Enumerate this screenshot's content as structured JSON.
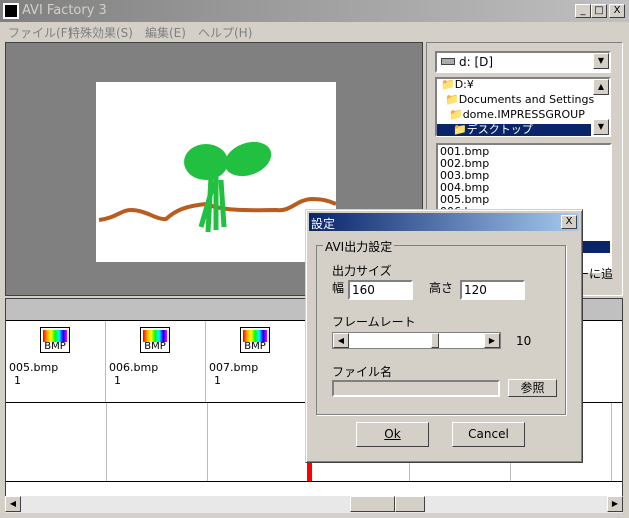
{
  "window": {
    "title": "AVI Factory 3",
    "min": "_",
    "max": "□",
    "close": "X"
  },
  "menu": [
    "ファイル(F)",
    "特殊効果(S)",
    "編集(E)",
    "ヘルプ(H)"
  ],
  "right_panel": {
    "drive": "d: [D]",
    "tree": [
      "D:¥",
      "Documents and Settings",
      "dome.IMPRESSGROUP",
      "デスクトップ"
    ],
    "files": [
      "001.bmp",
      "002.bmp",
      "003.bmp",
      "004.bmp",
      "005.bmp",
      "006.bmp"
    ],
    "add_label": "ーに追"
  },
  "timeline": {
    "frames": [
      {
        "icon": "BMP",
        "name": "005.bmp",
        "count": "1"
      },
      {
        "icon": "BMP",
        "name": "006.bmp",
        "count": "1"
      },
      {
        "icon": "BMP",
        "name": "007.bmp",
        "count": "1"
      }
    ],
    "cursor_color": "#ff0000"
  },
  "dialog": {
    "title": "設定",
    "close": "X",
    "group": "AVI出力設定",
    "size_label": "出力サイズ",
    "width_label": "幅",
    "width": "160",
    "height_label": "高さ",
    "height": "120",
    "framerate_label": "フレームレート",
    "framerate": "10",
    "framerate_slider_fraction": 0.55,
    "filename_label": "ファイル名",
    "filename": "",
    "browse": "参照",
    "ok": "Ok",
    "cancel": "Cancel"
  },
  "colors": {
    "selection": "#0a246a",
    "sprout": "#22c040",
    "soil": "#b85c20"
  }
}
